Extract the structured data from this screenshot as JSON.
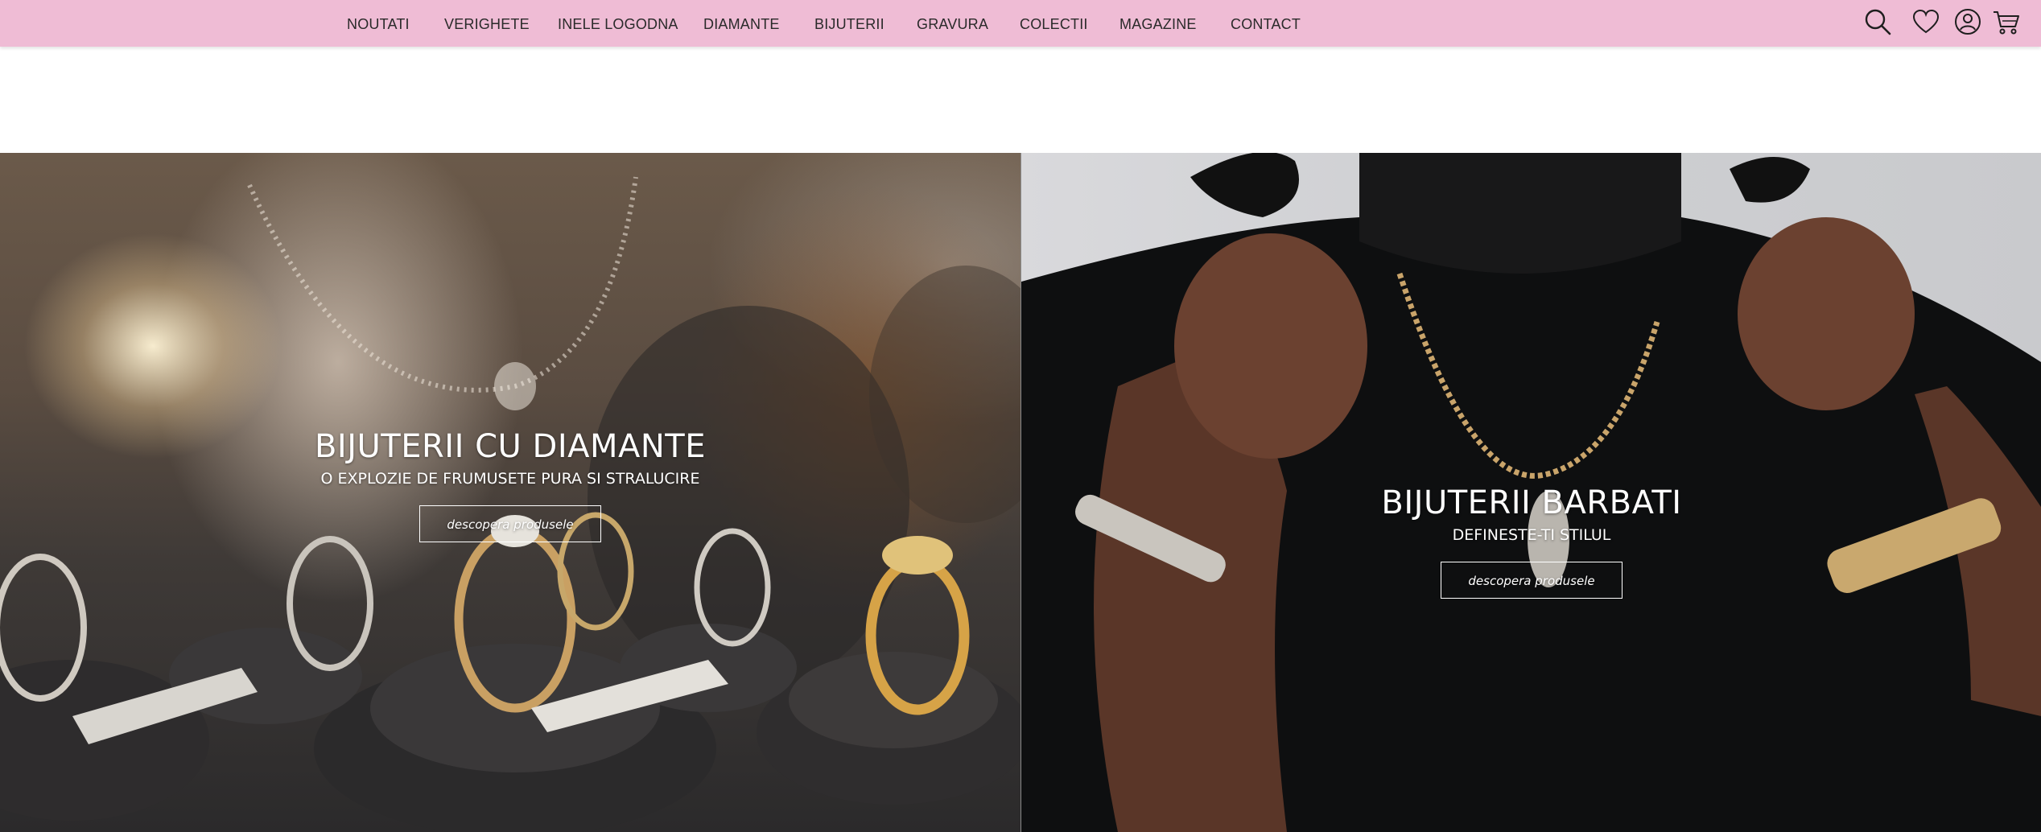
{
  "nav": {
    "items": [
      {
        "label": "NOUTATI"
      },
      {
        "label": "VERIGHETE"
      },
      {
        "label": "INELE LOGODNA"
      },
      {
        "label": "DIAMANTE"
      },
      {
        "label": "BIJUTERII"
      },
      {
        "label": "GRAVURA"
      },
      {
        "label": "COLECTII"
      },
      {
        "label": "MAGAZINE"
      },
      {
        "label": "CONTACT"
      }
    ]
  },
  "icons": [
    "search-icon",
    "heart-icon",
    "user-icon",
    "cart-icon"
  ],
  "colors": {
    "topbar": "#efbcd5",
    "text": "#2a2a2a",
    "overlay_text": "#ffffff"
  },
  "banners": {
    "left": {
      "title": "BIJUTERII CU DIAMANTE",
      "subtitle": "O EXPLOZIE DE FRUMUSETE PURA SI STRALUCIRE",
      "button": "descopera produsele"
    },
    "right": {
      "title": "BIJUTERII BARBATI",
      "subtitle": "DEFINESTE-TI STILUL",
      "button": "descopera produsele"
    }
  }
}
